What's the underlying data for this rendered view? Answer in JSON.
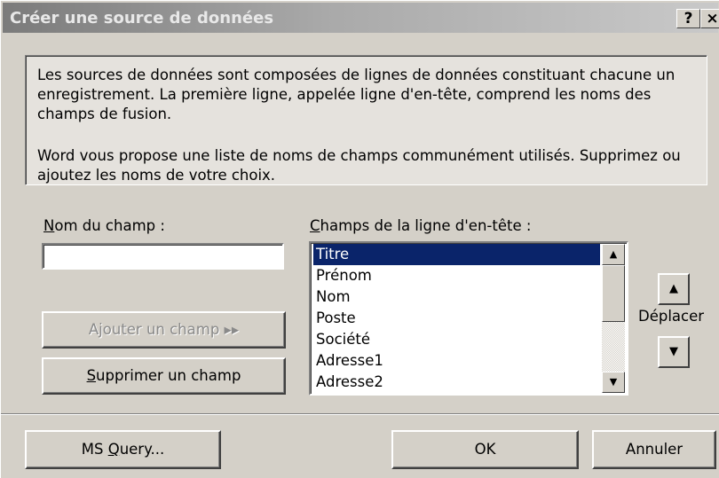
{
  "window": {
    "title": "Créer une source de données",
    "help_button": "?",
    "close_button": "×"
  },
  "info": {
    "paragraph1": "Les sources de données sont composées de lignes de données constituant chacune un enregistrement. La première ligne, appelée ligne d'en-tête, comprend les noms des champs de fusion.",
    "paragraph2": "Word vous propose une liste de noms de champs communément utilisés. Supprimez ou ajoutez les noms de votre choix."
  },
  "field": {
    "label_accel": "N",
    "label_rest": "om du champ :",
    "value": ""
  },
  "buttons": {
    "add_field": "Ajouter un champ ▸▸",
    "remove_field_accel": "S",
    "remove_field_rest": "upprimer un champ",
    "ms_query_prefix": "MS ",
    "ms_query_accel": "Q",
    "ms_query_rest": "uery...",
    "ok": "OK",
    "cancel": "Annuler"
  },
  "header_fields": {
    "label_accel": "C",
    "label_rest": "hamps de la ligne d'en-tête :",
    "selected": "Titre",
    "items": [
      "Titre",
      "Prénom",
      "Nom",
      "Poste",
      "Société",
      "Adresse1",
      "Adresse2"
    ]
  },
  "move": {
    "label": "Déplacer",
    "up_icon": "arrow-up-icon",
    "down_icon": "arrow-down-icon"
  },
  "colors": {
    "selection": "#0a246a",
    "face": "#d4d0c8"
  }
}
